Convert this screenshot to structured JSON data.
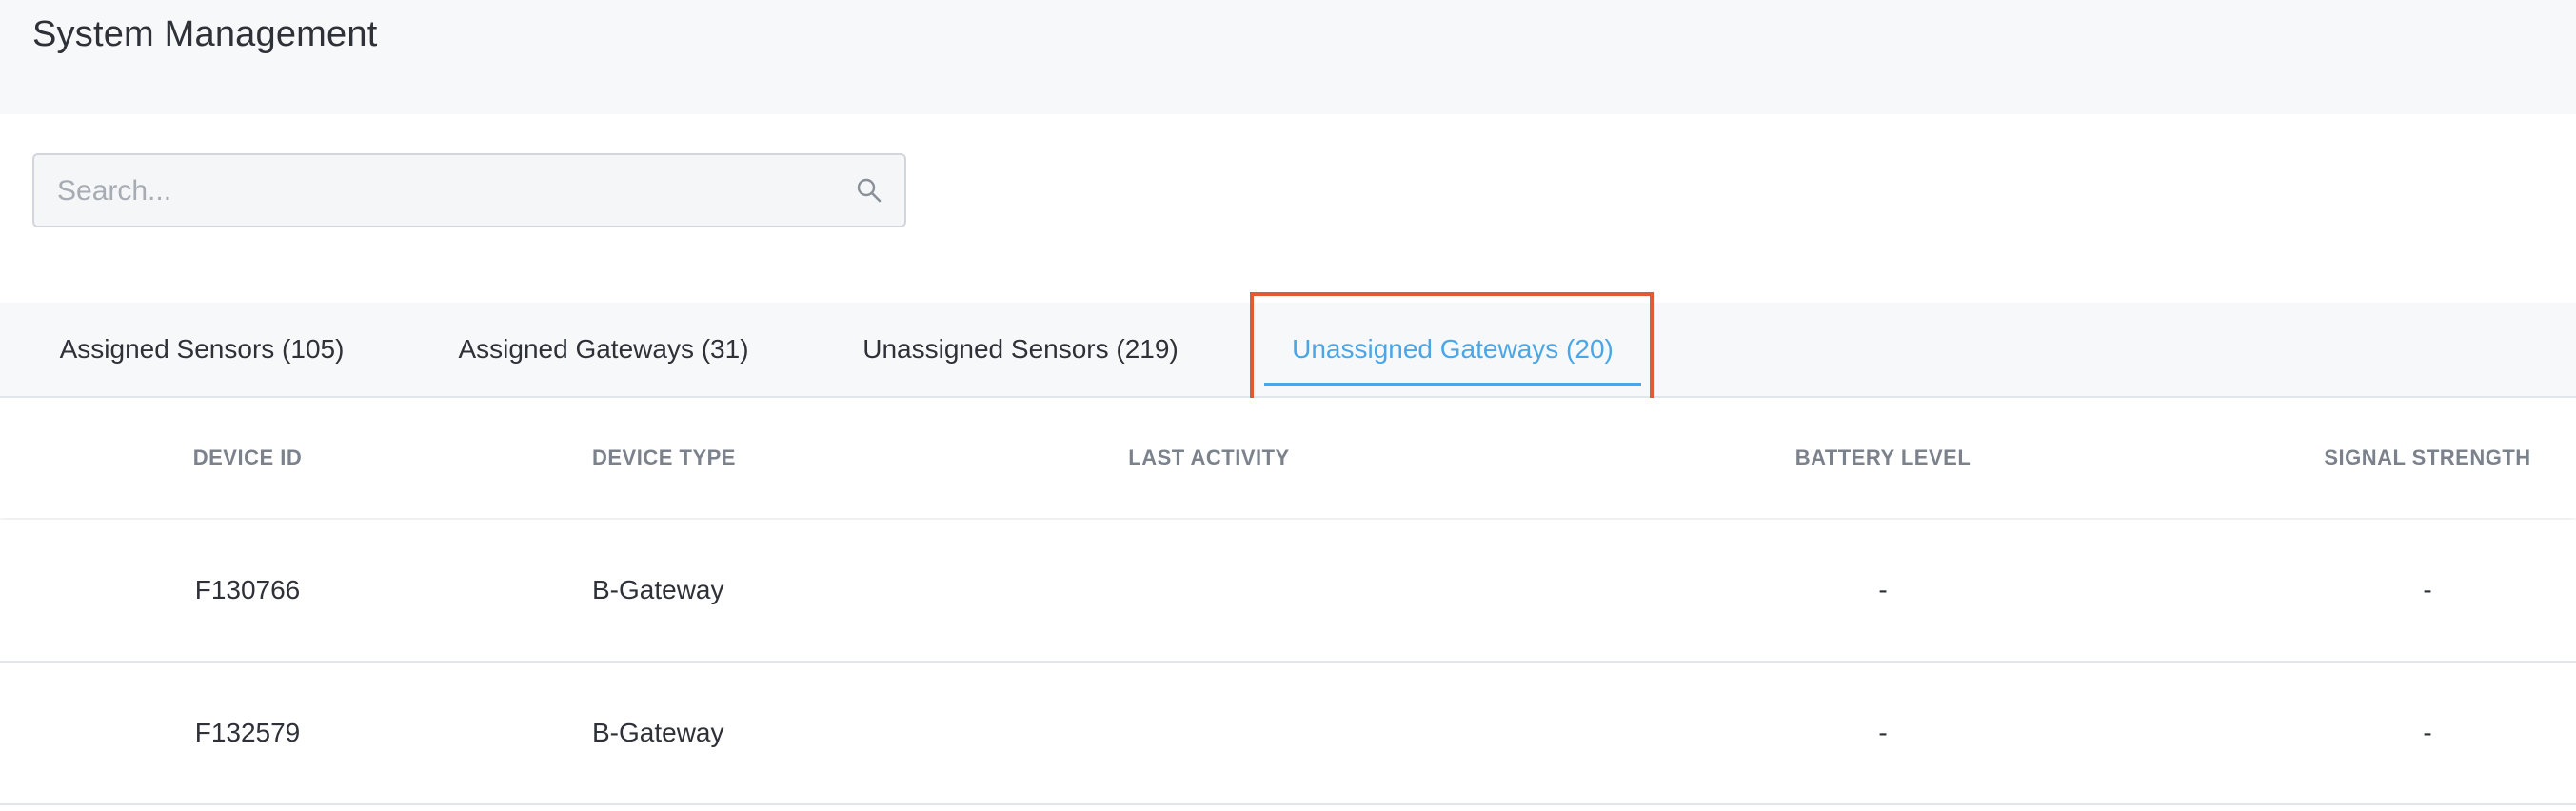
{
  "header": {
    "title": "System Management"
  },
  "search": {
    "placeholder": "Search..."
  },
  "tabs": [
    {
      "label": "Assigned Sensors (105)",
      "active": false
    },
    {
      "label": "Assigned Gateways (31)",
      "active": false
    },
    {
      "label": "Unassigned Sensors (219)",
      "active": false
    },
    {
      "label": "Unassigned Gateways (20)",
      "active": true
    }
  ],
  "table": {
    "columns": [
      "DEVICE ID",
      "DEVICE TYPE",
      "LAST ACTIVITY",
      "BATTERY LEVEL",
      "SIGNAL STRENGTH"
    ],
    "rows": [
      {
        "device_id": "F130766",
        "device_type": "B-Gateway",
        "last_activity": "",
        "battery_level": "-",
        "signal_strength": "-"
      },
      {
        "device_id": "F132579",
        "device_type": "B-Gateway",
        "last_activity": "",
        "battery_level": "-",
        "signal_strength": "-"
      }
    ]
  },
  "colors": {
    "accent": "#4aa6e6",
    "highlight": "#e05a33",
    "header_bg": "#f7f8f9"
  }
}
